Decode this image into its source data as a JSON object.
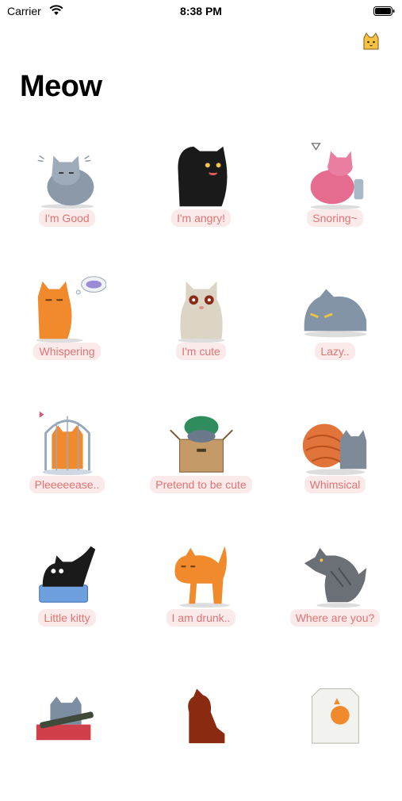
{
  "status_bar": {
    "carrier": "Carrier",
    "time": "8:38 PM"
  },
  "nav": {
    "title": "Meow",
    "right_icon": "cat-face-icon"
  },
  "colors": {
    "label_text": "#e07474",
    "label_bg": "#fbeaea"
  },
  "stickers": [
    {
      "label": "I'm Good",
      "icon": "gray-cat-content"
    },
    {
      "label": "I'm angry!",
      "icon": "black-cat-angry"
    },
    {
      "label": "Snoring~",
      "icon": "pink-cat-snoring"
    },
    {
      "label": "Whispering",
      "icon": "orange-cat-whispering"
    },
    {
      "label": "I'm cute",
      "icon": "cream-cat-cute"
    },
    {
      "label": "Lazy..",
      "icon": "gray-cat-lying"
    },
    {
      "label": "Pleeeeease..",
      "icon": "orange-cat-in-cage"
    },
    {
      "label": "Pretend to be cute",
      "icon": "cat-in-box"
    },
    {
      "label": "Whimsical",
      "icon": "cat-with-yarn"
    },
    {
      "label": "Little kitty",
      "icon": "black-cat-litter-box"
    },
    {
      "label": "I am drunk..",
      "icon": "orange-cat-stretching"
    },
    {
      "label": "Where are you?",
      "icon": "gray-cat-pouncing"
    },
    {
      "label": "",
      "icon": "gray-cat-cart"
    },
    {
      "label": "",
      "icon": "brown-cat-silhouette"
    },
    {
      "label": "",
      "icon": "cat-in-toilet"
    }
  ]
}
